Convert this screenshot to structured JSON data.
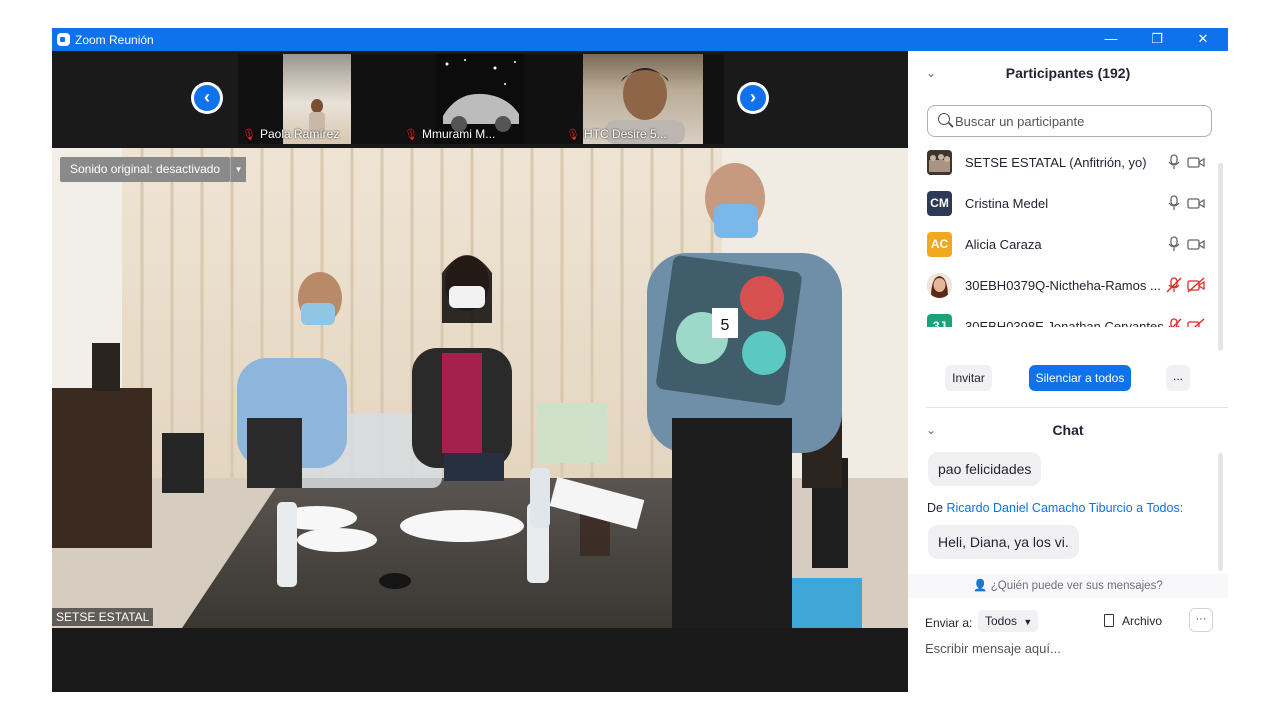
{
  "window": {
    "title": "Zoom Reunión",
    "min_glyph": "—",
    "restore_glyph": "❐",
    "close_glyph": "✕"
  },
  "gallery": {
    "thumbnails": [
      {
        "name": "Paola Ramírez"
      },
      {
        "name": "Mmurami M..."
      },
      {
        "name": "HTC Desire 5..."
      }
    ]
  },
  "main_video": {
    "original_sound": "Sonido original: desactivado",
    "speaker_label": "SETSE ESTATAL",
    "card_number": "5"
  },
  "participants": {
    "header": "Participantes (192)",
    "search_placeholder": "Buscar un participante",
    "list": [
      {
        "initials": "",
        "name": "SETSE ESTATAL (Anfitrión, yo)",
        "avatar_type": "photo",
        "mic_muted": false,
        "cam_off": false
      },
      {
        "initials": "CM",
        "name": "Cristina Medel",
        "avatar_color": "#2d3a56",
        "mic_muted": false,
        "cam_off": false
      },
      {
        "initials": "AC",
        "name": "Alicia  Caraza",
        "avatar_color": "#f0a81e",
        "mic_muted": false,
        "cam_off": false
      },
      {
        "initials": "",
        "name": "30EBH0379Q-Nictheha-Ramos ...",
        "avatar_type": "photo",
        "mic_muted": true,
        "cam_off": true
      },
      {
        "initials": "3J",
        "name": "30EBH0398E Jonathan Cervantes",
        "avatar_color": "#1aa37a",
        "mic_muted": true,
        "cam_off": true
      }
    ],
    "invite_label": "Invitar",
    "mute_all_label": "Silenciar a todos",
    "more_label": "..."
  },
  "chat": {
    "header": "Chat",
    "messages": [
      {
        "text": "pao felicidades"
      },
      {
        "from_prefix": "De",
        "from": "Ricardo Daniel Camacho Tiburcio",
        "to_prefix": "a",
        "to": "Todos:",
        "text": "Heli, Diana, ya los vi."
      }
    ],
    "who_sees": "¿Quién puede ver sus mensajes?",
    "send_to_label": "Enviar a:",
    "send_to_value": "Todos",
    "file_label": "Archivo",
    "options_label": "···",
    "input_placeholder": "Escribir mensaje aquí..."
  },
  "colors": {
    "accent": "#0e72ed",
    "muted_red": "#e02828"
  }
}
